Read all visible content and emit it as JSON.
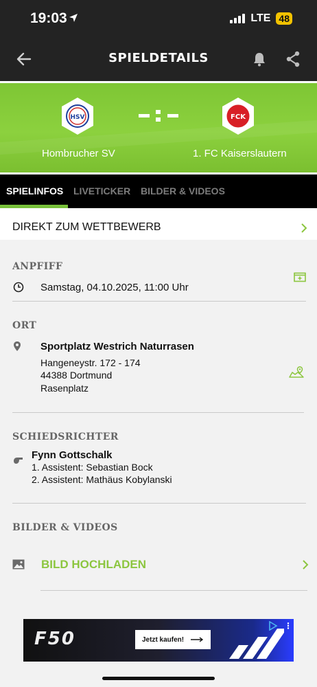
{
  "status_bar": {
    "time": "19:03",
    "network": "LTE",
    "battery": "48"
  },
  "nav": {
    "title": "SPIELDETAILS",
    "back_icon": "arrow-left-icon",
    "bell_icon": "bell-icon",
    "share_icon": "share-icon"
  },
  "match": {
    "home_team": "Hombrucher SV",
    "away_team": "1. FC Kaiserslautern",
    "score_display": "-:-",
    "home_crest_text": "HSV",
    "away_crest_text": "FCK",
    "accent_color": "#7ec634"
  },
  "tabs": [
    {
      "label": "SPIELINFOS",
      "active": true
    },
    {
      "label": "LIVETICKER",
      "active": false
    },
    {
      "label": "BILDER & VIDEOS",
      "active": false
    }
  ],
  "wettbewerb": {
    "label": "DIREKT ZUM WETTBEWERB"
  },
  "anpfiff": {
    "title": "ANPFIFF",
    "datetime": "Samstag, 04.10.2025, 11:00 Uhr"
  },
  "ort": {
    "title": "ORT",
    "venue": "Sportplatz Westrich Naturrasen",
    "street": "Hangeneystr. 172 - 174",
    "city": "44388 Dortmund",
    "surface": "Rasenplatz"
  },
  "schiedsrichter": {
    "title": "SCHIEDSRICHTER",
    "referee": "Fynn Gottschalk",
    "assistant_1": "1. Assistent: Sebastian Bock",
    "assistant_2": "2. Assistent: Mathäus Kobylanski"
  },
  "bilder": {
    "title": "BILDER & VIDEOS",
    "upload_label": "BILD HOCHLADEN"
  },
  "ad": {
    "logo_text": "F50",
    "cta": "Jetzt kaufen!"
  }
}
